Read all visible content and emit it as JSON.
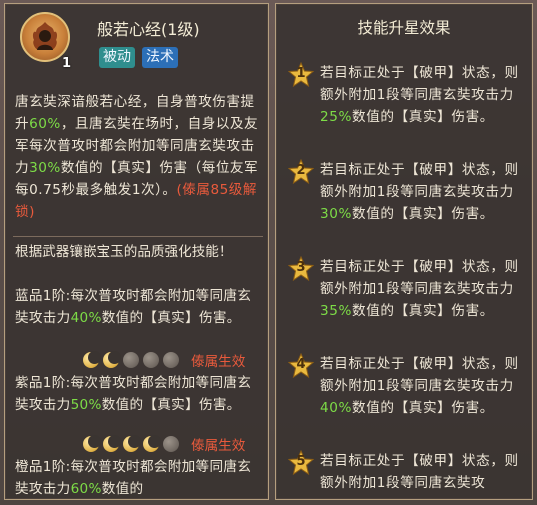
{
  "skill": {
    "title": "般若心经(1级)",
    "level": "1",
    "tags": [
      "被动",
      "法术"
    ],
    "icon": "flame-monk-icon",
    "description_parts": [
      {
        "text": "唐玄奘深谙般若心经，自身普攻伤害提升",
        "style": "normal"
      },
      {
        "text": "60%",
        "style": "green"
      },
      {
        "text": "，且唐玄奘在场时，自身以及友军每次普攻时都会附加等同唐玄奘攻击力",
        "style": "normal"
      },
      {
        "text": "30%",
        "style": "green"
      },
      {
        "text": "数值的【真实】伤害（每位友军每0.75秒最多触发1次）。",
        "style": "normal"
      },
      {
        "text": "(傣属85级解锁)",
        "style": "red"
      }
    ]
  },
  "gems": {
    "title": "根据武器镶嵌宝玉的品质强化技能！",
    "items": [
      {
        "label_prefix": "蓝品1阶:每次普攻时都会附加等同唐玄奘攻击力",
        "value": "40%",
        "label_suffix": "数值的【真实】伤害。",
        "moons_on": 2,
        "moons_total": 5,
        "effect": "傣属生效"
      },
      {
        "label_prefix": "紫品1阶:每次普攻时都会附加等同唐玄奘攻击力",
        "value": "50%",
        "label_suffix": "数值的【真实】伤害。",
        "moons_on": 4,
        "moons_total": 5,
        "effect": "傣属生效"
      },
      {
        "label_prefix": "橙品1阶:每次普攻时都会附加等同唐玄奘攻击力",
        "value": "60%",
        "label_suffix": "数值的",
        "moons_on": 0,
        "moons_total": 0,
        "effect": ""
      }
    ]
  },
  "star_upgrade": {
    "title": "技能升星效果",
    "items": [
      {
        "num": "1",
        "prefix": "若目标正处于【破甲】状态，则额外附加1段等同唐玄奘攻击力",
        "value": "25%",
        "suffix": "数值的【真实】伤害。"
      },
      {
        "num": "2",
        "prefix": "若目标正处于【破甲】状态，则额外附加1段等同唐玄奘攻击力",
        "value": "30%",
        "suffix": "数值的【真实】伤害。"
      },
      {
        "num": "3",
        "prefix": "若目标正处于【破甲】状态，则额外附加1段等同唐玄奘攻击力",
        "value": "35%",
        "suffix": "数值的【真实】伤害。"
      },
      {
        "num": "4",
        "prefix": "若目标正处于【破甲】状态，则额外附加1段等同唐玄奘攻击力",
        "value": "40%",
        "suffix": "数值的【真实】伤害。"
      },
      {
        "num": "5",
        "prefix": "若目标正处于【破甲】状态，则额外附加1段等同唐玄奘攻",
        "value": "",
        "suffix": ""
      }
    ]
  },
  "colors": {
    "highlight_green": "#7ddc47",
    "highlight_red": "#e85a3c",
    "tag_passive": "#2f8e8e",
    "tag_magic": "#2c6fb7"
  }
}
